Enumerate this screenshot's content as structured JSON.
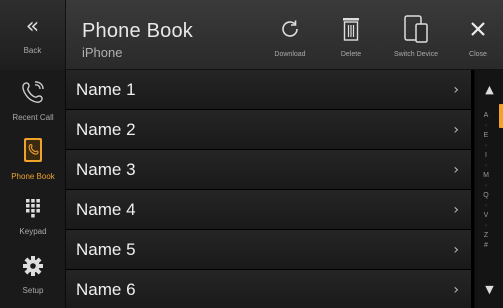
{
  "header": {
    "back_label": "Back",
    "title": "Phone Book",
    "subtitle": "iPhone",
    "buttons": {
      "download": "Download",
      "delete": "Delete",
      "switch_device": "Switch Device",
      "close": "Close"
    }
  },
  "sidebar": {
    "items": [
      {
        "label": "Recent Call",
        "icon": "recent-call-icon"
      },
      {
        "label": "Phone Book",
        "icon": "phone-book-icon",
        "active": true
      },
      {
        "label": "Keypad",
        "icon": "keypad-icon"
      },
      {
        "label": "Setup",
        "icon": "gear-icon"
      }
    ]
  },
  "contacts": [
    "Name 1",
    "Name 2",
    "Name 3",
    "Name 4",
    "Name 5",
    "Name 6"
  ],
  "scroll_index": [
    "A",
    "·",
    "E",
    "·",
    "I",
    "·",
    "M",
    "·",
    "Q",
    "·",
    "V",
    "·",
    "Z",
    "#"
  ],
  "colors": {
    "accent": "#f0a22a",
    "background": "#000000"
  }
}
